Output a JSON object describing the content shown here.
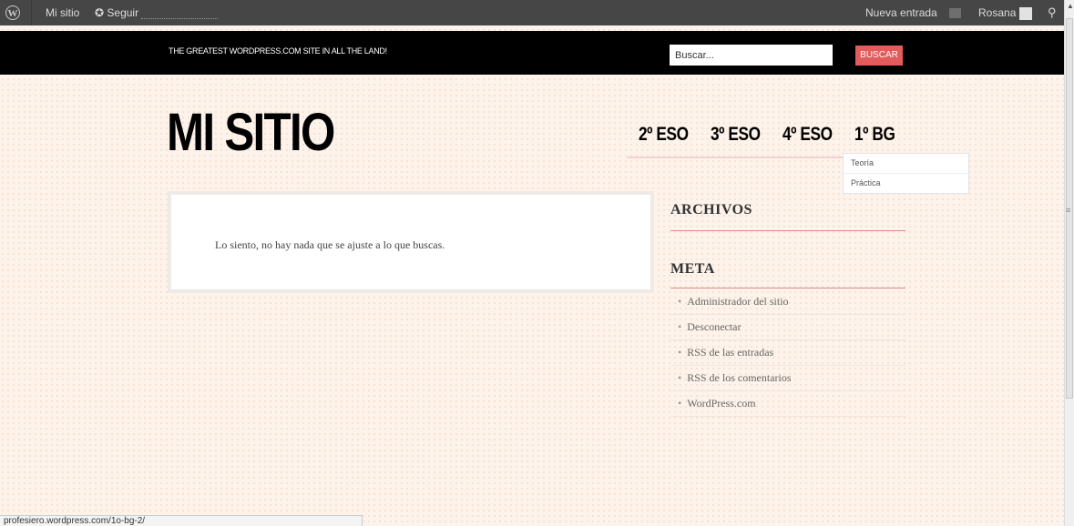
{
  "adminbar": {
    "wp_logo_icon": "wordpress-logo-icon",
    "my_site": "Mi sitio",
    "follow": "Seguir",
    "new_post": "Nueva entrada",
    "user": "Rosana"
  },
  "header": {
    "tagline": "THE GREATEST WORDPRESS.COM SITE IN ALL THE LAND!",
    "search_placeholder": "Buscar...",
    "search_button": "BUSCAR",
    "accent_color": "#e25c5c"
  },
  "site": {
    "title": "MI SITIO"
  },
  "nav": {
    "items": [
      "2º ESO",
      "3º ESO",
      "4º ESO",
      "1º BG"
    ],
    "submenu": [
      "Teoría",
      "Práctica"
    ]
  },
  "content": {
    "message": "Lo siento, no hay nada que se ajuste a lo que buscas."
  },
  "sidebar": {
    "archives_title": "ARCHIVOS",
    "meta_title": "META",
    "meta_links": [
      "Administrador del sitio",
      "Desconectar",
      "RSS de las entradas",
      "RSS de los comentarios",
      "WordPress.com"
    ]
  },
  "status": {
    "url": "profesiero.wordpress.com/1o-bg-2/"
  }
}
